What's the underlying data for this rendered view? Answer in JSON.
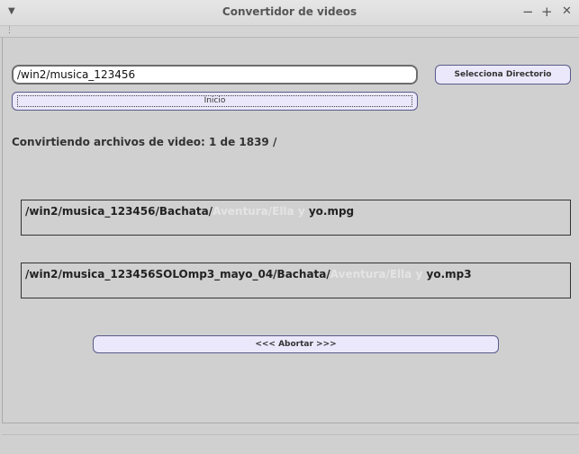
{
  "window": {
    "title": "Convertidor de videos",
    "menu_icon": "chevron-down-icon",
    "minimize_label": "−",
    "maximize_label": "+",
    "close_label": "✕"
  },
  "form": {
    "directory_value": "/win2/musica_123456",
    "select_directory_label": "Selecciona Directorio",
    "start_label": "Inicio"
  },
  "progress": {
    "label": "Convirtiendo archivos de video: 1 de 1839 /"
  },
  "source_file": {
    "prefix": "/win2/musica_123456/Bachata/",
    "faded": "Aventura/Ella y",
    "suffix": " yo.mpg"
  },
  "target_file": {
    "prefix": "/win2/musica_123456SOLOmp3_mayo_04/Bachata/",
    "faded": "Aventura/Ella y",
    "suffix": " yo.mp3"
  },
  "abort_label": "<<< Abortar >>>",
  "colors": {
    "background": "#d0d0d0",
    "button_fill": "#ebe8fb",
    "button_border": "#5a5a8a"
  }
}
